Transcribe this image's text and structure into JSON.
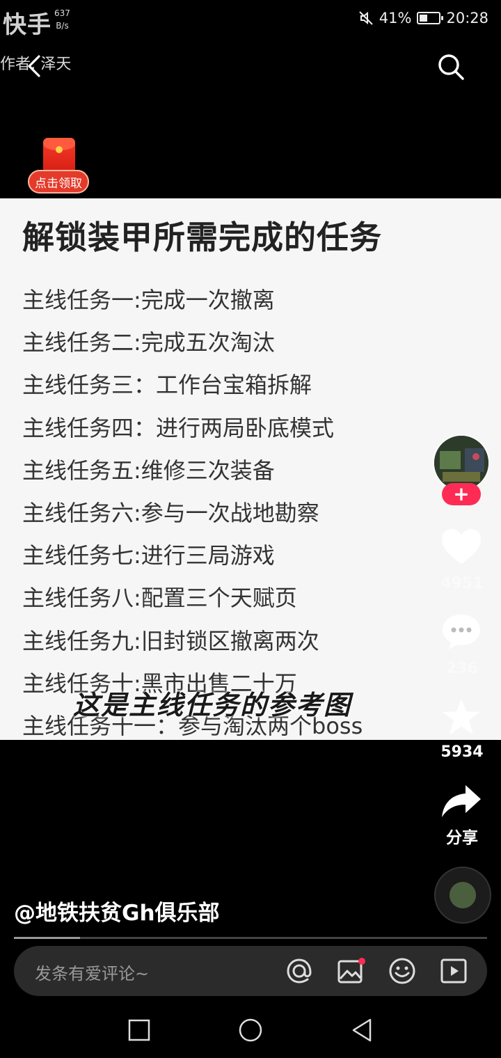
{
  "status_bar": {
    "app_watermark": "快手",
    "net_speed_value": "637",
    "net_speed_unit": "B/s",
    "battery": "41%",
    "battery_level": 0.41,
    "time": "20:28"
  },
  "header": {
    "author_watermark": "作者: 泽天"
  },
  "red_packet": {
    "label": "点击领取"
  },
  "content": {
    "title": "解锁装甲所需完成的任务",
    "tasks": [
      "主线任务一:完成一次撤离",
      "主线任务二:完成五次淘汰",
      "主线任务三：工作台宝箱拆解",
      "主线任务四：进行两局卧底模式",
      "主线任务五:维修三次装备",
      "主线任务六:参与一次战地勘察",
      "主线任务七:进行三局游戏",
      "主线任务八:配置三个天赋页",
      "主线任务九:旧封锁区撤离两次",
      "主线任务十:黑市出售二十万",
      "主线任务十一：参与淘汰两个boss"
    ],
    "subtitle": "这是主线任务的参考图"
  },
  "rail": {
    "follow": "+",
    "likes": "4951",
    "comments": "236",
    "favorites": "5934",
    "share_label": "分享"
  },
  "video": {
    "author_handle": "@地铁扶贫Gh俱乐部",
    "progress": 0.14
  },
  "comment": {
    "placeholder": "发条有爱评论~"
  },
  "colors": {
    "accent": "#fe2c55",
    "red_packet": "#e43a2a",
    "background": "#000000",
    "content_bg": "#f6f6f6"
  },
  "icons": {
    "back": "chevron-left-icon",
    "search": "search-icon",
    "like": "heart-icon",
    "comment": "comment-bubble-icon",
    "favorite": "star-icon",
    "share": "share-arrow-icon",
    "at": "at-icon",
    "image": "image-icon",
    "emoji": "emoji-icon",
    "video": "play-icon"
  }
}
